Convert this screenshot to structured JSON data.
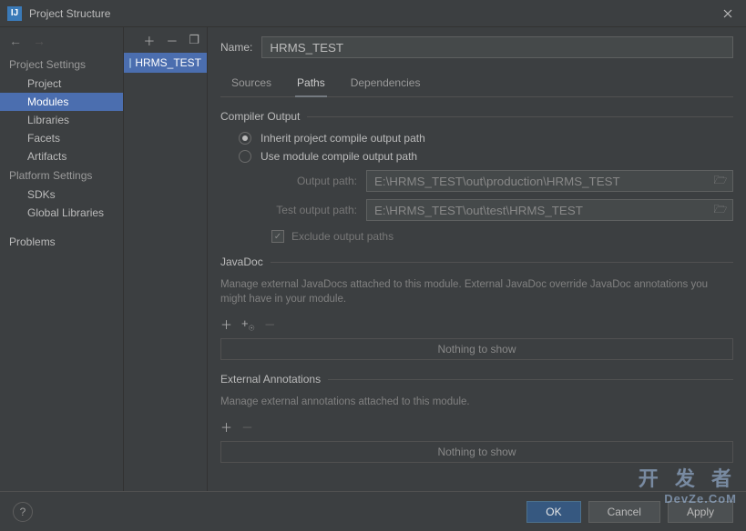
{
  "window": {
    "title": "Project Structure",
    "app_icon_letter": "IJ"
  },
  "sidebar": {
    "section1": "Project Settings",
    "items1": [
      "Project",
      "Modules",
      "Libraries",
      "Facets",
      "Artifacts"
    ],
    "section2": "Platform Settings",
    "items2": [
      "SDKs",
      "Global Libraries"
    ],
    "section3_item": "Problems"
  },
  "module_list": {
    "items": [
      "HRMS_TEST"
    ]
  },
  "main": {
    "name_label": "Name:",
    "name_value": "HRMS_TEST",
    "tabs": [
      "Sources",
      "Paths",
      "Dependencies"
    ],
    "compiler": {
      "title": "Compiler Output",
      "radio_inherit": "Inherit project compile output path",
      "radio_module": "Use module compile output path",
      "output_label": "Output path:",
      "output_value": "E:\\HRMS_TEST\\out\\production\\HRMS_TEST",
      "test_label": "Test output path:",
      "test_value": "E:\\HRMS_TEST\\out\\test\\HRMS_TEST",
      "exclude_label": "Exclude output paths"
    },
    "javadoc": {
      "title": "JavaDoc",
      "desc": "Manage external JavaDocs attached to this module. External JavaDoc override JavaDoc annotations you might have in your module.",
      "empty": "Nothing to show"
    },
    "ext": {
      "title": "External Annotations",
      "desc": "Manage external annotations attached to this module.",
      "empty": "Nothing to show"
    }
  },
  "footer": {
    "ok": "OK",
    "cancel": "Cancel",
    "apply": "Apply"
  },
  "watermark": {
    "line1": "开 发 者",
    "line2": "DevZe.CoM"
  }
}
